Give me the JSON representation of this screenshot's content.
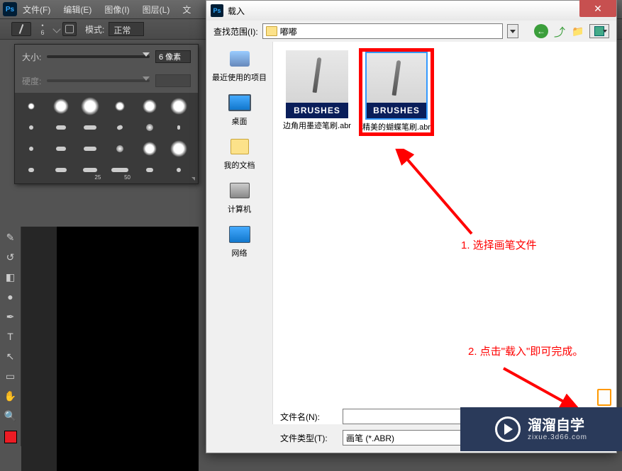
{
  "menubar": {
    "file": "文件(F)",
    "edit": "编辑(E)",
    "image": "图像(I)",
    "layer": "图层(L)",
    "text": "文"
  },
  "options": {
    "brush_num": "6",
    "mode_label": "模式:",
    "mode_value": "正常"
  },
  "brush_panel": {
    "size_label": "大小:",
    "size_value": "6 像素",
    "hardness_label": "硬度:",
    "nums": {
      "n25": "25",
      "n50": "50"
    }
  },
  "dialog": {
    "title": "载入",
    "lookin_label": "查找范围(I):",
    "lookin_value": "嘟嘟",
    "places": {
      "recent": "最近使用的项目",
      "desktop": "桌面",
      "docs": "我的文档",
      "computer": "计算机",
      "network": "网络"
    },
    "files": [
      {
        "name": "边角用墨迹笔刷.abr"
      },
      {
        "name": "精美的蝴蝶笔刷.abr"
      }
    ],
    "filename_label": "文件名(N):",
    "filetype_label": "文件类型(T):",
    "filetype_value": "画笔 (*.ABR)"
  },
  "annotations": {
    "a1": "1. 选择画笔文件",
    "a2": "2. 点击\"载入\"即可完成。"
  },
  "watermark": {
    "main": "溜溜自学",
    "sub": "zixue.3d66.com"
  }
}
